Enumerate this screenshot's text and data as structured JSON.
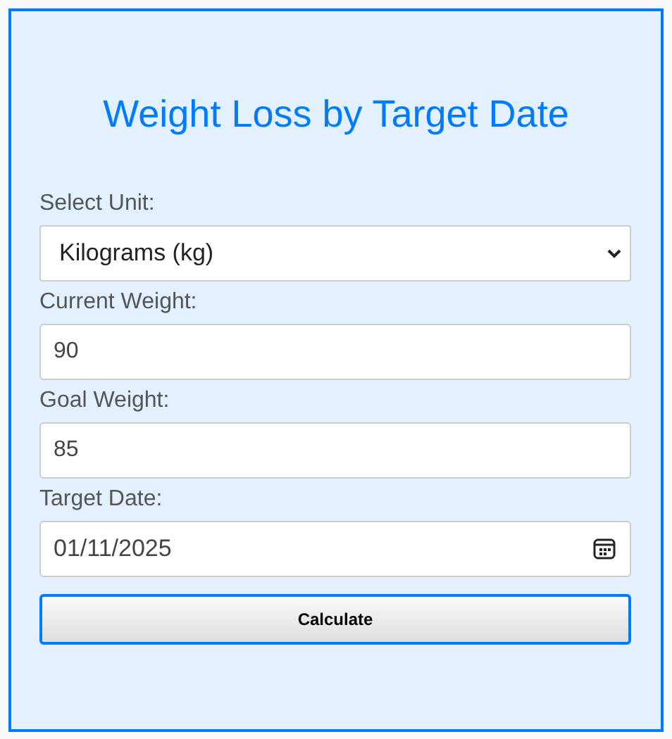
{
  "title": "Weight Loss by Target Date",
  "fields": [
    {
      "kind": "select",
      "label": "Select Unit:",
      "value": "Kilograms (kg)"
    },
    {
      "kind": "number",
      "label": "Current Weight:",
      "value": "90"
    },
    {
      "kind": "number",
      "label": "Goal Weight:",
      "value": "85"
    },
    {
      "kind": "date",
      "label": "Target Date:",
      "value": "01/11/2025"
    }
  ],
  "button": "Calculate"
}
